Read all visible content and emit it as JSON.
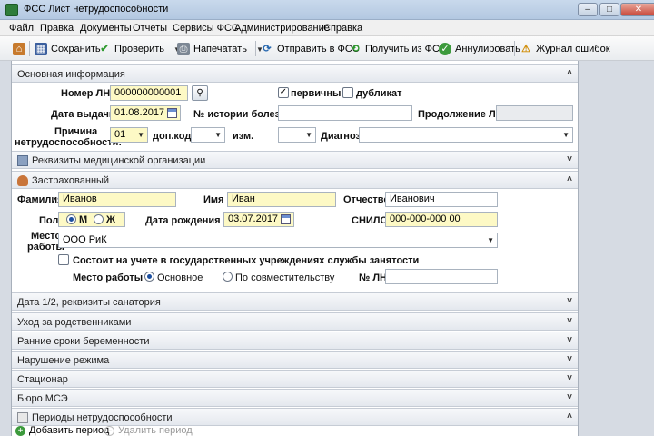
{
  "window": {
    "title": "ФСС Лист нетрудоспособности"
  },
  "menu": [
    "Файл",
    "Правка",
    "Документы",
    "Отчеты",
    "Сервисы ФСС",
    "Администрирование",
    "Справка"
  ],
  "toolbar": {
    "save": "Сохранить",
    "check": "Проверить",
    "print": "Напечатать",
    "send": "Отправить в ФСС",
    "receive": "Получить из ФСС",
    "annul": "Аннулировать",
    "log": "Журнал ошибок"
  },
  "sections": {
    "main": "Основная информация",
    "med_org": "Реквизиты медицинской организации",
    "insured": "Застрахованный",
    "date12": "Дата 1/2, реквизиты санатория",
    "care": "Уход за родственниками",
    "pregnancy": "Ранние сроки беременности",
    "violation": "Нарушение режима",
    "hospital": "Стационар",
    "mse": "Бюро МСЭ",
    "periods": "Периоды нетрудоспособности"
  },
  "main_info": {
    "ln_number_label": "Номер ЛН",
    "ln_number": "000000000001",
    "primary_label": "первичный",
    "primary_checked": true,
    "duplicate_label": "дубликат",
    "duplicate_checked": false,
    "issue_date_label": "Дата выдачи",
    "issue_date": "01.08.2017",
    "history_label": "№ истории болезни",
    "history_value": "",
    "continuation_label": "Продолжение ЛН",
    "continuation_value": "",
    "reason_label_1": "Причина",
    "reason_label_2": "нетрудоспособности:",
    "reason_value": "01",
    "extra_code_label": "доп.код",
    "change_label": "изм.",
    "diagnosis_label": "Диагноз"
  },
  "insured": {
    "last_name_label": "Фамилия",
    "last_name": "Иванов",
    "first_name_label": "Имя",
    "first_name": "Иван",
    "patronymic_label": "Отчество",
    "patronymic": "Иванович",
    "gender_label": "Пол",
    "gender_m": "М",
    "gender_f": "Ж",
    "gender_selected": "М",
    "birth_date_label": "Дата рождения",
    "birth_date": "03.07.2017",
    "snils_label": "СНИЛС",
    "snils": "000-000-000 00",
    "workplace_label_1": "Место",
    "workplace_label_2": "работы",
    "workplace": "ООО РиК",
    "employment_checkbox": "Состоит на учете в государственных учреждениях службы занятости",
    "employment_checked": false,
    "work_type_label": "Место работы",
    "work_main": "Основное",
    "work_part": "По совместительству",
    "work_selected": "Основное",
    "ln_no_label": "№ ЛН",
    "ln_no_value": ""
  },
  "bottom": {
    "add_period": "Добавить период",
    "delete_period": "Удалить период"
  },
  "colors": {
    "required_field": "#fdf9c5",
    "section_header": "#e4e8ee",
    "titlebar": "#b3c8e1"
  }
}
